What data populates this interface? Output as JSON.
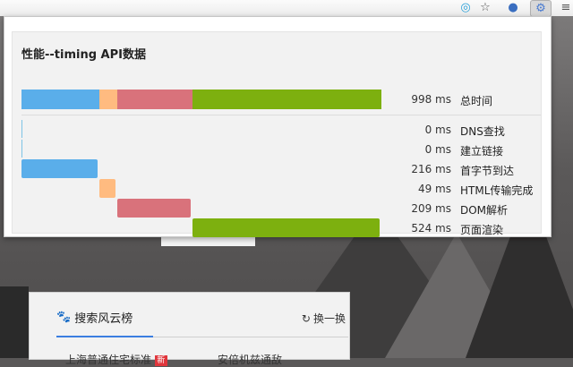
{
  "popup": {
    "title": "性能--timing API数据",
    "total": {
      "value": "998",
      "unit": "ms",
      "label": "总时间"
    },
    "rows": [
      {
        "value": "0",
        "unit": "ms",
        "label": "DNS查找"
      },
      {
        "value": "0",
        "unit": "ms",
        "label": "建立链接"
      },
      {
        "value": "216",
        "unit": "ms",
        "label": "首字节到达"
      },
      {
        "value": "49",
        "unit": "ms",
        "label": "HTML传输完成"
      },
      {
        "value": "209",
        "unit": "ms",
        "label": "DOM解析"
      },
      {
        "value": "524",
        "unit": "ms",
        "label": "页面渲染"
      }
    ],
    "segment_colors": [
      "#5aaeea",
      "#ffbb80",
      "#d9727b",
      "#7db00f"
    ]
  },
  "background_card": {
    "title": "搜索风云榜",
    "refresh_label": "换一换",
    "row1": "上海普通住宅标准",
    "row1_badge": "新",
    "row2": "安倍机兹通敌"
  },
  "toolbar": {
    "icons": [
      "chrome-swirl-icon",
      "star-icon",
      "globe-icon",
      "extension-icon",
      "menu-icon"
    ]
  }
}
